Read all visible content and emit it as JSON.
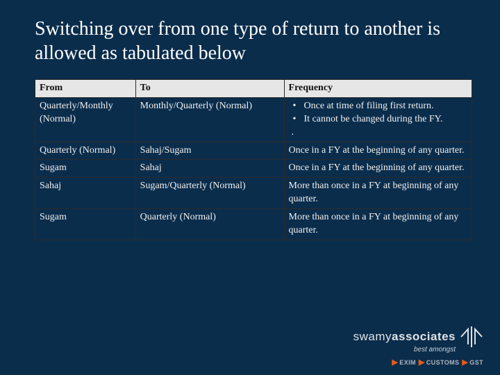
{
  "title": "Switching over from one type of return to another is allowed as tabulated below",
  "table": {
    "headers": {
      "from": "From",
      "to": "To",
      "freq": "Frequency"
    },
    "rows": [
      {
        "from": "Quarterly/Monthly (Normal)",
        "to": "Monthly/Quarterly (Normal)",
        "freq_bullets": [
          "Once at time of filing first return.",
          "It cannot be changed during the FY."
        ],
        "freq_suffix": "."
      },
      {
        "from": "Quarterly (Normal)",
        "to": "Sahaj/Sugam",
        "freq_text": "Once in a FY at the beginning of any quarter."
      },
      {
        "from": "Sugam",
        "to": "Sahaj",
        "freq_text": "Once in a FY at the beginning of any quarter."
      },
      {
        "from": "Sahaj",
        "to": "Sugam/Quarterly (Normal)",
        "freq_text": "More than once in a FY at beginning of any quarter."
      },
      {
        "from": "Sugam",
        "to": "Quarterly (Normal)",
        "freq_text": "More than once in a FY at beginning of any quarter."
      }
    ]
  },
  "brand": {
    "name_light": "swamy",
    "name_bold": "associates",
    "tagline": "best amongst",
    "pillars": [
      "EXIM",
      "CUSTOMS",
      "GST"
    ]
  }
}
